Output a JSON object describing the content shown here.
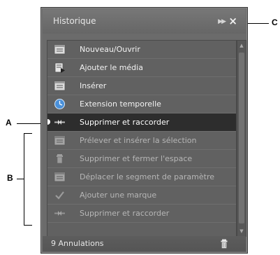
{
  "callouts": {
    "a": "A",
    "b": "B",
    "c": "C"
  },
  "panel": {
    "title": "Historique",
    "menu_icon": "flyout-menu-icon",
    "close_icon": "close-icon"
  },
  "history": [
    {
      "label": "Nouveau/Ouvrir",
      "icon": "document-list-icon",
      "state": "done"
    },
    {
      "label": "Ajouter le média",
      "icon": "add-media-icon",
      "state": "done"
    },
    {
      "label": "Insérer",
      "icon": "document-list-icon",
      "state": "done"
    },
    {
      "label": "Extension temporelle",
      "icon": "time-stretch-icon",
      "state": "done"
    },
    {
      "label": "Supprimer et raccorder",
      "icon": "ripple-delete-icon",
      "state": "current"
    },
    {
      "label": "Prélever et insérer la sélection",
      "icon": "document-list-icon",
      "state": "undone"
    },
    {
      "label": "Supprimer et fermer l'espace",
      "icon": "trash-icon",
      "state": "undone"
    },
    {
      "label": "Déplacer le segment de paramètre",
      "icon": "document-list-icon",
      "state": "undone"
    },
    {
      "label": "Ajouter une marque",
      "icon": "checkmark-icon",
      "state": "undone"
    },
    {
      "label": "Supprimer et raccorder",
      "icon": "ripple-delete-icon",
      "state": "undone"
    }
  ],
  "status": {
    "undo_count": "9 Annulations",
    "delete_icon": "trash-icon"
  },
  "colors": {
    "panel_bg": "#6b6b6b",
    "list_bg": "#616161",
    "active_row": "#2d2d2d",
    "text": "#f2f2f2",
    "undone_text": "#b6b6b6"
  }
}
